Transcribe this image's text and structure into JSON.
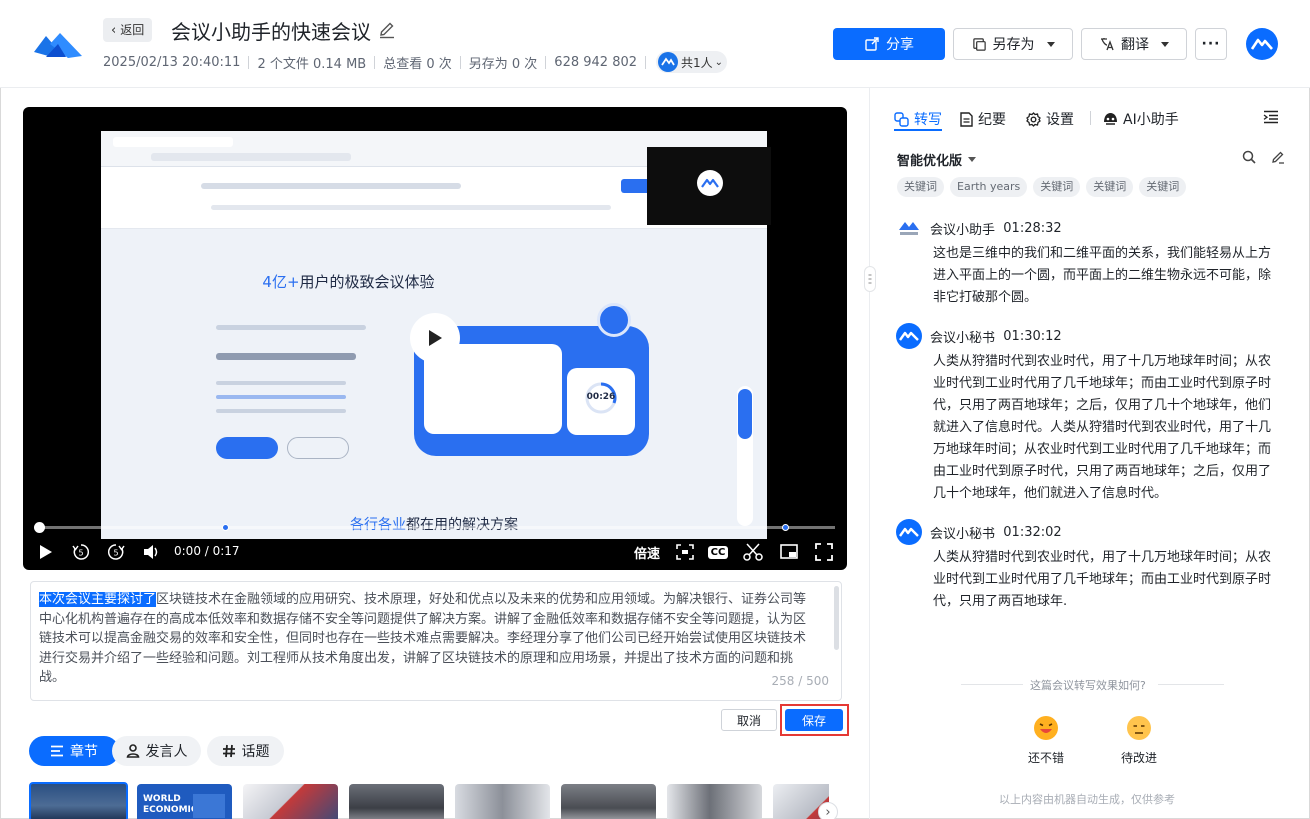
{
  "header": {
    "back_label": "返回",
    "title": "会议小助手的快速会议",
    "date": "2025/02/13 20:40:11",
    "files": "2 个文件 0.14 MB",
    "views": "总查看 0 次",
    "saves": "另存为 0 次",
    "meeting_id": "628 942 802",
    "shared_with": "共1人",
    "share_label": "分享",
    "save_as_label": "另存为",
    "translate_label": "翻译",
    "more_label": "···"
  },
  "video": {
    "time": "0:00 / 0:17",
    "progress": 0,
    "speed_label": "倍速",
    "cc_label": "CC",
    "screen_headline_accent": "4亿+",
    "screen_headline_rest": "用户的极致会议体验",
    "screen_footer_accent": "各行各业",
    "screen_footer_rest": "都在用的解决方案",
    "timer_text": "00:26"
  },
  "summary": {
    "selected_text": "本次会议主要探讨了",
    "rest_text": "区块链技术在金融领域的应用研究、技术原理，好处和优点以及未来的优势和应用领域。为解决银行、证券公司等中心化机构普遍存在的高成本低效率和数据存储不安全等问题提供了解决方案。讲解了金融低效率和数据存储不安全等问题提，认为区链技术可以提高金融交易的效率和安全性，但同时也存在一些技术难点需要解决。李经理分享了他们公司已经开始尝试使用区块链技术进行交易并介绍了一些经验和问题。刘工程师从技术角度出发，讲解了区块链技术的原理和应用场景，并提出了技术方面的问题和挑战。",
    "counter": "258 / 500",
    "cancel_label": "取消",
    "save_label": "保存"
  },
  "bottom_tabs": {
    "chapters": "章节",
    "speakers": "发言人",
    "topics": "话题",
    "thumb2_line1": "WORLD",
    "thumb2_line2": "ECONOMIC"
  },
  "right_panel": {
    "tabs": {
      "transcript": "转写",
      "minutes": "纪要",
      "settings": "设置",
      "ai": "AI小助手"
    },
    "mode": "智能优化版",
    "keywords": [
      "关键词",
      "Earth years",
      "关键词",
      "关键词",
      "关键词"
    ],
    "entries": [
      {
        "speaker": "会议小助手",
        "time": "01:28:32",
        "text": "这也是三维中的我们和二维平面的关系，我们能轻易从上方进入平面上的一个圆，而平面上的二维生物永远不可能，除非它打破那个圆。"
      },
      {
        "speaker": "会议小秘书",
        "time": "01:30:12",
        "text": "人类从狩猎时代到农业时代，用了十几万地球年时间；从农业时代到工业时代用了几千地球年；而由工业时代到原子时代，只用了两百地球年；之后，仅用了几十个地球年，他们就进入了信息时代。人类从狩猎时代到农业时代，用了十几万地球年时间；从农业时代到工业时代用了几千地球年；而由工业时代到原子时代，只用了两百地球年；之后，仅用了几十个地球年，他们就进入了信息时代。"
      },
      {
        "speaker": "会议小秘书",
        "time": "01:32:02",
        "text": "人类从狩猎时代到农业时代，用了十几万地球年时间；从农业时代到工业时代用了几千地球年；而由工业时代到原子时代，只用了两百地球年."
      }
    ],
    "feedback_question": "这篇会议转写效果如何?",
    "feedback_good": "还不错",
    "feedback_bad": "待改进",
    "disclaimer": "以上内容由机器自动生成，仅供参考"
  },
  "colors": {
    "accent": "#0a6cff",
    "highlight_border": "#e53935"
  }
}
